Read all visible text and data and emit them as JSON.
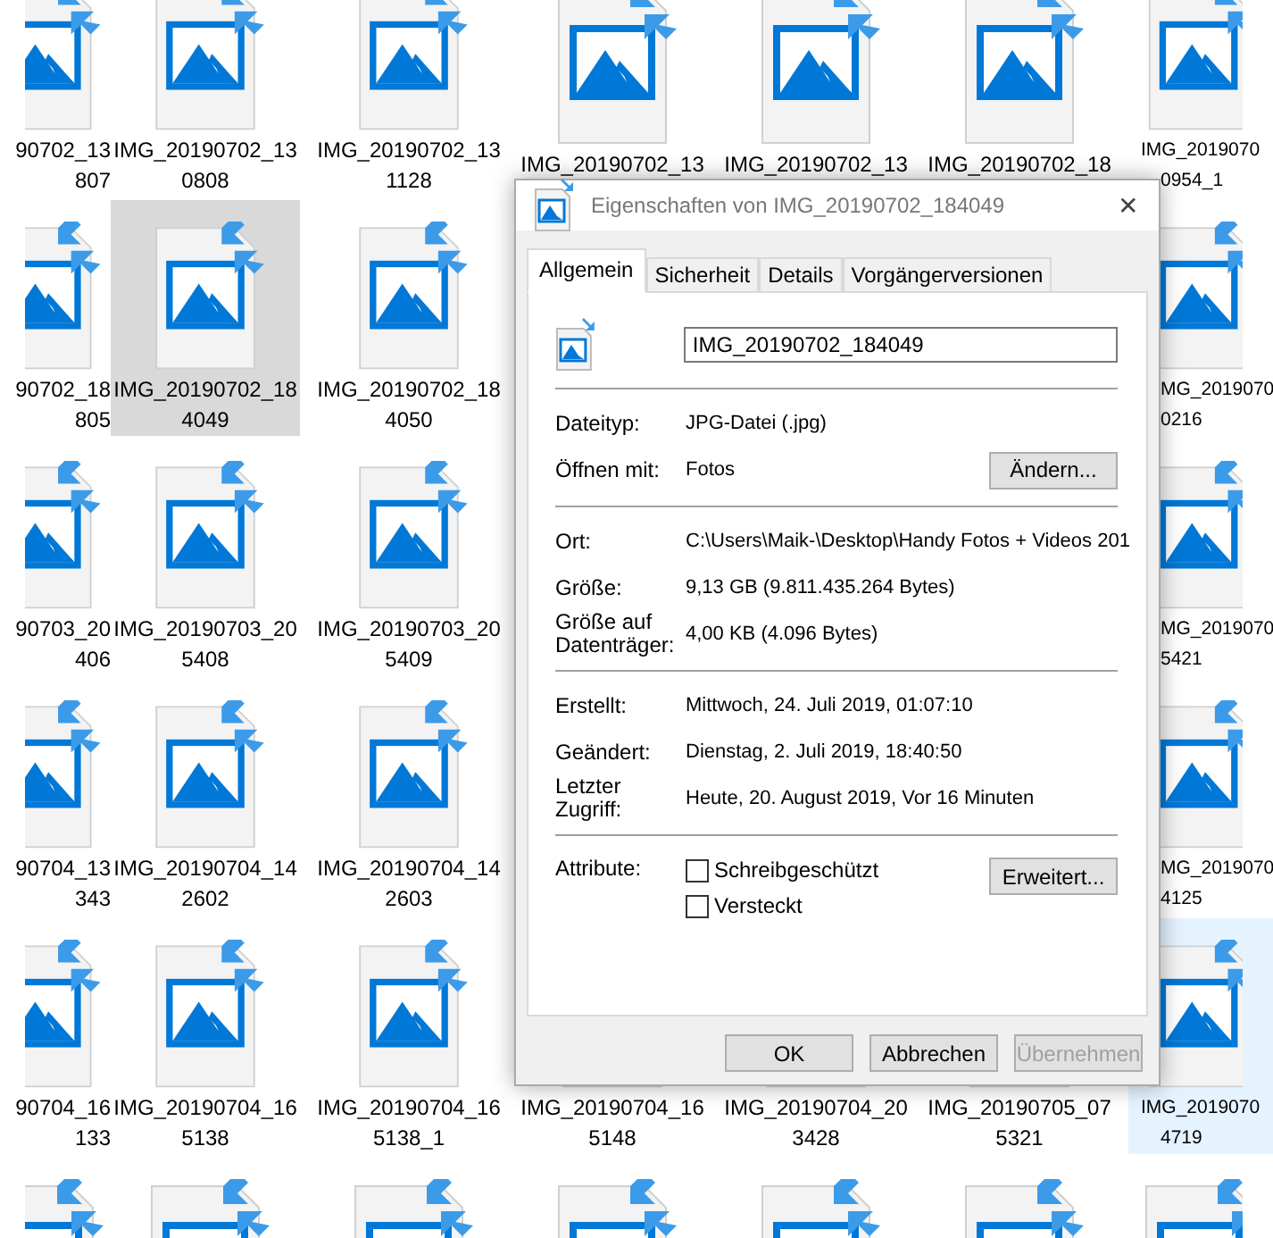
{
  "explorer": {
    "rows": [
      {
        "files": [
          {
            "label_lines": [
              "90702_13",
              "807"
            ],
            "selected": false,
            "hovered": false
          },
          {
            "label_lines": [
              "IMG_20190702_13",
              "0808"
            ],
            "selected": false,
            "hovered": false
          },
          {
            "label_lines": [
              "IMG_20190702_13",
              "1128"
            ],
            "selected": false,
            "hovered": false
          },
          {
            "label_lines": [
              "IMG_20190702_13"
            ],
            "selected": false,
            "hovered": false
          },
          {
            "label_lines": [
              "IMG_20190702_13"
            ],
            "selected": false,
            "hovered": false
          },
          {
            "label_lines": [
              "IMG_20190702_18"
            ],
            "selected": false,
            "hovered": false
          },
          {
            "label_lines": [
              "IMG_2019070",
              "0954_1"
            ],
            "selected": false,
            "hovered": false
          }
        ]
      },
      {
        "files": [
          {
            "label_lines": [
              "90702_18",
              "805"
            ],
            "selected": false,
            "hovered": false
          },
          {
            "label_lines": [
              "IMG_20190702_18",
              "4049"
            ],
            "selected": true,
            "hovered": false
          },
          {
            "label_lines": [
              "IMG_20190702_18",
              "4050"
            ],
            "selected": false,
            "hovered": false
          },
          {
            "label_lines": [
              "MG_2019070",
              "0216"
            ],
            "selected": false,
            "hovered": false
          }
        ]
      },
      {
        "files": [
          {
            "label_lines": [
              "90703_20",
              "406"
            ],
            "selected": false,
            "hovered": false
          },
          {
            "label_lines": [
              "IMG_20190703_20",
              "5408"
            ],
            "selected": false,
            "hovered": false
          },
          {
            "label_lines": [
              "IMG_20190703_20",
              "5409"
            ],
            "selected": false,
            "hovered": false
          },
          {
            "label_lines": [
              "MG_2019070",
              "5421"
            ],
            "selected": false,
            "hovered": false
          }
        ]
      },
      {
        "files": [
          {
            "label_lines": [
              "90704_13",
              "343"
            ],
            "selected": false,
            "hovered": false
          },
          {
            "label_lines": [
              "IMG_20190704_14",
              "2602"
            ],
            "selected": false,
            "hovered": false
          },
          {
            "label_lines": [
              "IMG_20190704_14",
              "2603"
            ],
            "selected": false,
            "hovered": false
          },
          {
            "label_lines": [
              "MG_2019070",
              "4125"
            ],
            "selected": false,
            "hovered": false
          }
        ]
      },
      {
        "files": [
          {
            "label_lines": [
              "90704_16",
              "133"
            ],
            "selected": false,
            "hovered": false
          },
          {
            "label_lines": [
              "IMG_20190704_16",
              "5138"
            ],
            "selected": false,
            "hovered": false
          },
          {
            "label_lines": [
              "IMG_20190704_16",
              "5138_1"
            ],
            "selected": false,
            "hovered": false
          },
          {
            "label_lines": [
              "IMG_20190704_16",
              "5148"
            ],
            "selected": false,
            "hovered": false
          },
          {
            "label_lines": [
              "IMG_20190704_20",
              "3428"
            ],
            "selected": false,
            "hovered": false
          },
          {
            "label_lines": [
              "IMG_20190705_07",
              "5321"
            ],
            "selected": false,
            "hovered": false
          },
          {
            "label_lines": [
              "IMG_2019070",
              "4719"
            ],
            "selected": false,
            "hovered": true
          }
        ]
      }
    ]
  },
  "dialog": {
    "title": "Eigenschaften von IMG_20190702_184049",
    "close": "✕",
    "tabs": [
      {
        "label": "Allgemein",
        "selected": true
      },
      {
        "label": "Sicherheit",
        "selected": false
      },
      {
        "label": "Details",
        "selected": false
      },
      {
        "label": "Vorgängerversionen",
        "selected": false
      }
    ],
    "file_name": "IMG_20190702_184049",
    "sections": [
      [
        {
          "label": "Dateityp:",
          "value": "JPG-Datei (.jpg)"
        },
        {
          "label": "Öffnen mit:",
          "value": "Fotos",
          "button": "Ändern..."
        }
      ],
      [
        {
          "label": "Ort:",
          "value": "C:\\Users\\Maik-\\Desktop\\Handy Fotos + Videos 201"
        },
        {
          "label": "Größe:",
          "value": "9,13 GB (9.811.435.264 Bytes)"
        },
        {
          "label": "Größe auf Datenträger:",
          "value": "4,00 KB (4.096 Bytes)"
        }
      ],
      [
        {
          "label": "Erstellt:",
          "value": "Mittwoch, 24. Juli 2019, 01:07:10"
        },
        {
          "label": "Geändert:",
          "value": "Dienstag, 2. Juli 2019, 18:40:50"
        },
        {
          "label": "Letzter Zugriff:",
          "value": "Heute, 20. August 2019, Vor 16 Minuten"
        }
      ]
    ],
    "attributes": {
      "label": "Attribute:",
      "options": [
        {
          "label": "Schreibgeschützt",
          "checked": false
        },
        {
          "label": "Versteckt",
          "checked": false
        }
      ],
      "button": "Erweitert..."
    },
    "buttons": [
      {
        "label": "OK",
        "disabled": false
      },
      {
        "label": "Abbrechen",
        "disabled": false
      },
      {
        "label": "Übernehmen",
        "disabled": true
      }
    ]
  }
}
